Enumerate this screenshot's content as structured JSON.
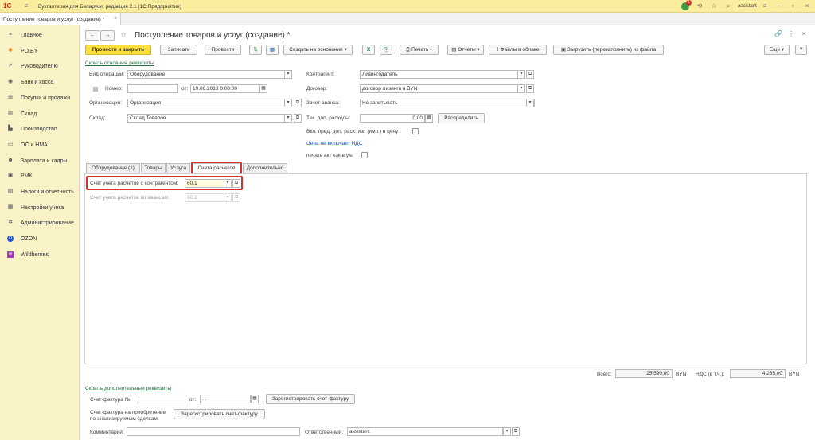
{
  "app": {
    "title": "Бухгалтерия для Беларуси, редакция 2.1 (1С:Предприятие)",
    "user": "assistant",
    "notif_count": "1"
  },
  "doc_tab": {
    "label": "Поступление товаров и услуг (создание) *"
  },
  "sidebar": {
    "items": [
      {
        "label": "Главное",
        "icon": "menu-icon"
      },
      {
        "label": "PO.BY",
        "icon": "sun-icon"
      },
      {
        "label": "Руководителю",
        "icon": "chart-icon"
      },
      {
        "label": "Банк и касса",
        "icon": "bank-icon"
      },
      {
        "label": "Покупки и продажи",
        "icon": "cart-icon"
      },
      {
        "label": "Склад",
        "icon": "warehouse-icon"
      },
      {
        "label": "Производство",
        "icon": "factory-icon"
      },
      {
        "label": "ОС и НМА",
        "icon": "car-icon"
      },
      {
        "label": "Зарплата и кадры",
        "icon": "people-icon"
      },
      {
        "label": "РМК",
        "icon": "kassa-icon"
      },
      {
        "label": "Налоги и отчетность",
        "icon": "tax-icon"
      },
      {
        "label": "Настройки учета",
        "icon": "settings-doc-icon"
      },
      {
        "label": "Администрирование",
        "icon": "gear-icon"
      },
      {
        "label": "OZON",
        "icon": "ozon-icon"
      },
      {
        "label": "Wildberries",
        "icon": "wb-icon"
      }
    ]
  },
  "form": {
    "title": "Поступление товаров и услуг (создание) *",
    "toolbar": {
      "post_close": "Провести и закрыть",
      "save": "Записать",
      "post": "Провести",
      "create_based": "Создать на основании",
      "print": "Печать",
      "reports": "Отчеты",
      "files_cloud": "Файлы в облаке",
      "upload": "Загрузить (перезаполнить) из файла",
      "more": "Еще",
      "help": "?"
    },
    "hide_main_link": "Скрыть основные реквизиты",
    "left": {
      "op_type_label": "Вид операции:",
      "op_type": "Оборудование",
      "number_label": "Номер:",
      "number": "",
      "date_label": "от:",
      "date": "19.06.2018  0:00:00",
      "org_label": "Организация:",
      "org": "Организация",
      "warehouse_label": "Склад:",
      "warehouse": "Склад Товаров"
    },
    "right": {
      "contractor_label": "Контрагент:",
      "contractor": "Лизингодатель",
      "contract_label": "Договор:",
      "contract": "договор лизинга в BYN",
      "advance_label": "Зачет аванса:",
      "advance": "Не зачитывать",
      "extra_costs_label": "Тек. доп. расходы:",
      "extra_costs": "0,00",
      "distribute": "Распределить",
      "incl_costs_label": "Вкл. пред. доп. расх. изг. (имп.) в цену :",
      "price_vat_link": "Цена не включает НДС",
      "print_act_label": "печать акт как в у.е:"
    },
    "tabs": [
      {
        "label": "Оборудование (1)"
      },
      {
        "label": "Товары"
      },
      {
        "label": "Услуги"
      },
      {
        "label": "Счета расчетов"
      },
      {
        "label": "Дополнительно"
      }
    ],
    "accounts": {
      "contractor_acc_label": "Счет учета расчетов с контрагентом:",
      "contractor_acc": "60.1",
      "advance_acc_label": "Счет учета расчетов по авансам:",
      "advance_acc": "60.1"
    },
    "totals": {
      "total_label": "Всего:",
      "total": "25 590,00",
      "currency": "BYN",
      "vat_label": "НДС (в т.ч.):",
      "vat": "4 265,00",
      "vat_currency": "BYN"
    },
    "hide_extra_link": "Скрыть дополнительные реквизиты",
    "invoice": {
      "label": "Счет-фактура №:",
      "number": "",
      "date_label": "от:",
      "date": " .  . ",
      "register": "Зарегистрировать счет-фактуру"
    },
    "invoice2": {
      "label_line1": "Счет-фактура на приобретение",
      "label_line2": "по анализируемым сделкам:",
      "register": "Зарегистрировать счет-фактуру"
    },
    "comment": {
      "label": "Комментарий:",
      "value": ""
    },
    "responsible": {
      "label": "Ответственный:",
      "value": "assistant"
    }
  },
  "colors": {
    "accent_yellow": "#fcde3d",
    "sidebar_bg": "#fbf3c8",
    "titlebar_bg": "#fbed9e",
    "highlight_red": "#d9322b",
    "link_green": "#2d6f47"
  }
}
